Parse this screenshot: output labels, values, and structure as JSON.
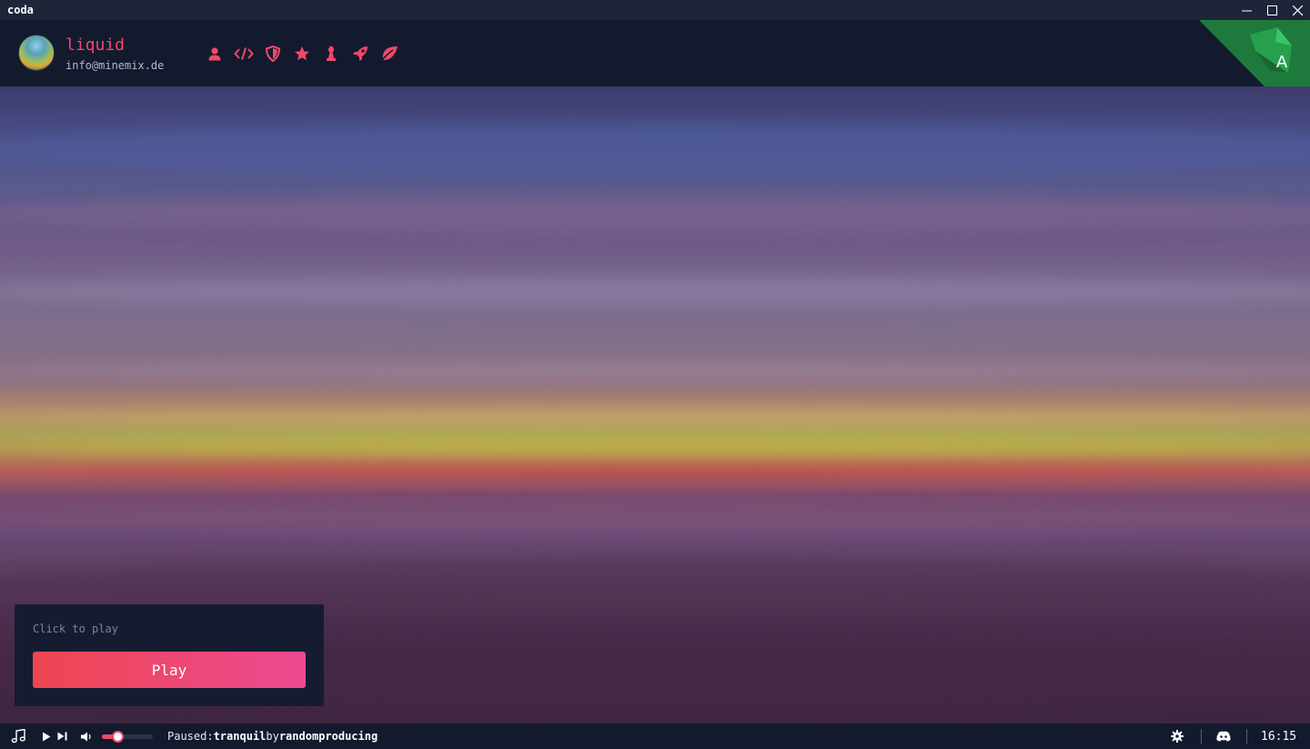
{
  "window": {
    "title": "coda",
    "controls": [
      "minimize-icon",
      "maximize-icon",
      "close-icon"
    ]
  },
  "header": {
    "username": "liquid",
    "email": "info@minemix.de",
    "nav_icons": [
      "user-icon",
      "code-icon",
      "shield-icon",
      "star-icon",
      "chess-rook-icon",
      "rocket-icon",
      "leaf-icon"
    ],
    "corner_badge_letter": "A",
    "accent_color": "#f2476a",
    "corner_color": "#1e7a3c"
  },
  "play_card": {
    "hint": "Click to play",
    "button_label": "Play"
  },
  "player": {
    "status": "Paused:",
    "track": "tranquil",
    "by": "by",
    "artist": "randomproducing",
    "volume": 0.3,
    "icons": [
      "music-note-icon",
      "play-icon",
      "skip-next-icon",
      "volume-icon"
    ]
  },
  "status_bar": {
    "icons": [
      "gear-icon",
      "discord-icon"
    ],
    "time": "16:15"
  }
}
